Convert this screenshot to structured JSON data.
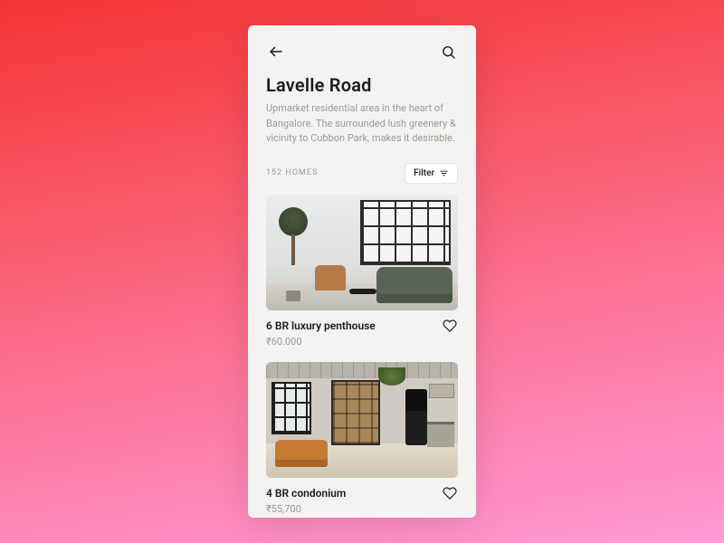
{
  "header": {
    "title": "Lavelle Road",
    "description": "Upmarket residential area in the heart of Bangalore. The surrounded lush greenery & vicinity to Cubbon Park, makes it desirable."
  },
  "meta": {
    "count_label": "152 HOMES",
    "filter_label": "Filter"
  },
  "listings": [
    {
      "title": "6 BR luxury penthouse",
      "price": "₹60.000"
    },
    {
      "title": "4 BR condonium",
      "price": "₹55,700"
    }
  ]
}
